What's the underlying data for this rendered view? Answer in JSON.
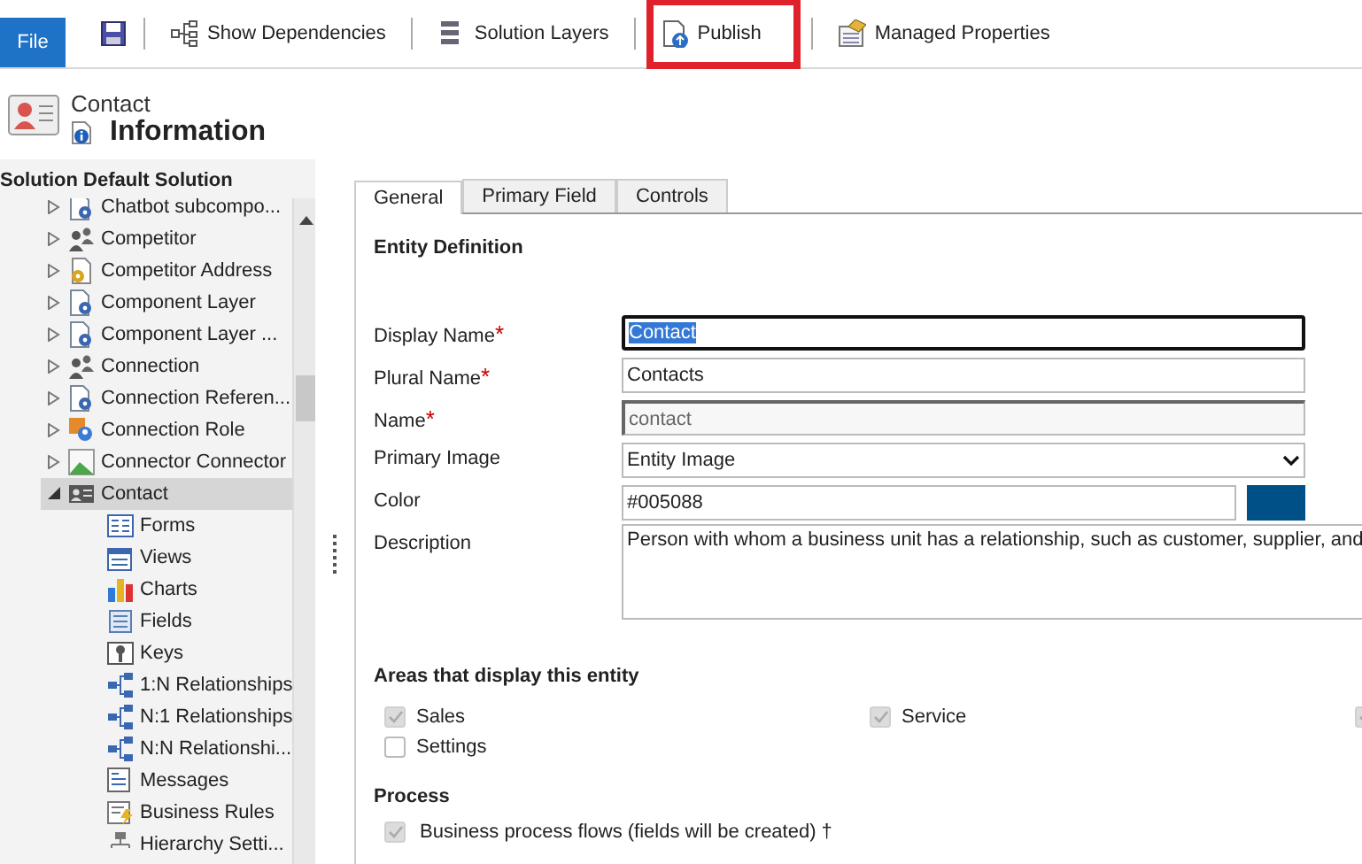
{
  "toolbar": {
    "file_tab": "File",
    "items": [
      {
        "kind": "dependencies",
        "label": "Show Dependencies",
        "highlighted": false
      },
      {
        "kind": "layers",
        "label": "Solution Layers",
        "highlighted": false
      },
      {
        "kind": "publish",
        "label": "Publish",
        "highlighted": true
      },
      {
        "kind": "properties",
        "label": "Managed Properties",
        "highlighted": false
      }
    ]
  },
  "header": {
    "entity": "Contact",
    "title": "Information"
  },
  "solution_label": "Solution Default Solution",
  "tree": [
    {
      "label": "Chatbot subcompo...",
      "kind": "gear-doc",
      "expanded": false,
      "selected": false
    },
    {
      "label": "Competitor",
      "kind": "people",
      "expanded": false,
      "selected": false
    },
    {
      "label": "Competitor Address",
      "kind": "address",
      "expanded": false,
      "selected": false
    },
    {
      "label": "Component Layer",
      "kind": "gear-doc",
      "expanded": false,
      "selected": false
    },
    {
      "label": "Component Layer ...",
      "kind": "gear-doc",
      "expanded": false,
      "selected": false
    },
    {
      "label": "Connection",
      "kind": "people",
      "expanded": false,
      "selected": false
    },
    {
      "label": "Connection Referen...",
      "kind": "gear-doc",
      "expanded": false,
      "selected": false
    },
    {
      "label": "Connection Role",
      "kind": "role",
      "expanded": false,
      "selected": false
    },
    {
      "label": "Connector Connector",
      "kind": "image",
      "expanded": false,
      "selected": false
    },
    {
      "label": "Contact",
      "kind": "card",
      "expanded": true,
      "selected": true,
      "children": [
        {
          "label": "Forms",
          "kind": "form"
        },
        {
          "label": "Views",
          "kind": "view"
        },
        {
          "label": "Charts",
          "kind": "chart"
        },
        {
          "label": "Fields",
          "kind": "fields"
        },
        {
          "label": "Keys",
          "kind": "key"
        },
        {
          "label": "1:N Relationships",
          "kind": "rel"
        },
        {
          "label": "N:1 Relationships",
          "kind": "rel"
        },
        {
          "label": "N:N Relationshi...",
          "kind": "rel"
        },
        {
          "label": "Messages",
          "kind": "message"
        },
        {
          "label": "Business Rules",
          "kind": "rule"
        },
        {
          "label": "Hierarchy Setti...",
          "kind": "hierarchy"
        }
      ]
    }
  ],
  "tabs": [
    {
      "label": "General",
      "selected": true
    },
    {
      "label": "Primary Field",
      "selected": false
    },
    {
      "label": "Controls",
      "selected": false
    }
  ],
  "form": {
    "section_title": "Entity Definition",
    "fields": [
      {
        "kind": "text",
        "label": "Display Name",
        "required_mark": "*",
        "value": "Contact",
        "focused": true
      },
      {
        "kind": "text",
        "label": "Plural Name",
        "required_mark": "*",
        "value": "Contacts",
        "focused": false
      },
      {
        "kind": "readonly",
        "label": "Name",
        "required_mark": "*",
        "value": "contact"
      },
      {
        "kind": "select",
        "label": "Primary Image",
        "value": "Entity Image"
      },
      {
        "kind": "color",
        "label": "Color",
        "value": "#005088"
      },
      {
        "kind": "textarea",
        "label": "Description",
        "value": "Person with whom a business unit has a relationship, such as customer, supplier, and"
      }
    ]
  },
  "areas": {
    "title": "Areas that display this entity",
    "items": [
      {
        "label": "Sales",
        "checked": true,
        "disabled": true
      },
      {
        "label": "Service",
        "checked": true,
        "disabled": true
      },
      {
        "checked": true,
        "disabled": true
      },
      {
        "label": "Settings",
        "checked": false,
        "disabled": false
      }
    ]
  },
  "process": {
    "title": "Process",
    "items": [
      {
        "label": "Business process flows (fields will be created) †",
        "checked": true,
        "disabled": true
      }
    ]
  }
}
